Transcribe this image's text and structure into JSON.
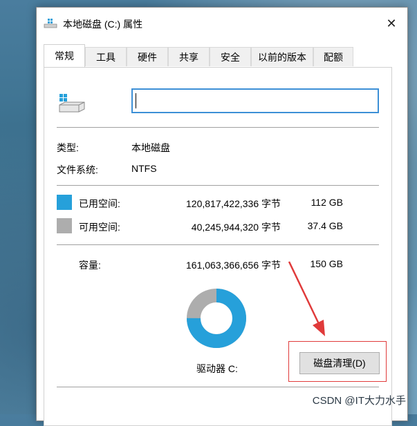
{
  "window": {
    "title": "本地磁盘 (C:) 属性",
    "close_glyph": "✕"
  },
  "tabs": [
    {
      "label": "常规",
      "active": true
    },
    {
      "label": "工具",
      "active": false
    },
    {
      "label": "硬件",
      "active": false
    },
    {
      "label": "共享",
      "active": false
    },
    {
      "label": "安全",
      "active": false
    },
    {
      "label": "以前的版本",
      "active": false
    },
    {
      "label": "配额",
      "active": false
    }
  ],
  "general": {
    "name_value": "",
    "type_label": "类型:",
    "type_value": "本地磁盘",
    "fs_label": "文件系统:",
    "fs_value": "NTFS",
    "used_label": "已用空间:",
    "used_bytes": "120,817,422,336 字节",
    "used_size": "112 GB",
    "free_label": "可用空间:",
    "free_bytes": "40,245,944,320 字节",
    "free_size": "37.4 GB",
    "capacity_label": "容量:",
    "capacity_bytes": "161,063,366,656 字节",
    "capacity_size": "150 GB",
    "drive_label": "驱动器 C:",
    "cleanup_button": "磁盘清理(D)",
    "used_fraction": 0.75
  },
  "colors": {
    "used": "#26a0da",
    "free": "#adadad",
    "highlight": "#e03a3a"
  },
  "watermark": "CSDN @IT大力水手"
}
